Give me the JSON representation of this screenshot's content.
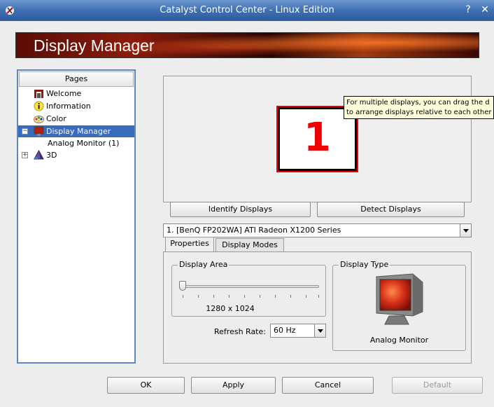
{
  "window": {
    "title": "Catalyst Control Center - Linux Edition"
  },
  "banner": {
    "title": "Display Manager"
  },
  "pages": {
    "header": "Pages",
    "items": [
      {
        "label": "Welcome",
        "icon": "welcome-icon"
      },
      {
        "label": "Information",
        "icon": "information-icon"
      },
      {
        "label": "Color",
        "icon": "color-icon"
      },
      {
        "label": "Display Manager",
        "icon": "display-manager-icon",
        "selected": true
      },
      {
        "label": "Analog Monitor (1)"
      },
      {
        "label": "3D",
        "icon": "3d-icon"
      }
    ]
  },
  "preview": {
    "monitor_number": "1",
    "tooltip_line1": "For multiple displays, you can drag the d",
    "tooltip_line2": "to arrange displays relative to each other"
  },
  "buttons": {
    "identify": "Identify Displays",
    "detect": "Detect Displays",
    "ok": "OK",
    "apply": "Apply",
    "cancel": "Cancel",
    "default": "Default"
  },
  "display_select": {
    "value": "1.  [BenQ FP202WA] ATI Radeon X1200 Series"
  },
  "tabs": {
    "properties": "Properties",
    "display_modes": "Display Modes"
  },
  "display_area": {
    "title": "Display Area",
    "resolution": "1280 x 1024",
    "slider_position": 0
  },
  "refresh_rate": {
    "label": "Refresh Rate:",
    "value": "60 Hz"
  },
  "display_type": {
    "title": "Display Type",
    "value": "Analog Monitor"
  },
  "colors": {
    "titlebar": "#3f6fb2",
    "selection": "#3a6bbd",
    "accent_red": "#e00000"
  }
}
